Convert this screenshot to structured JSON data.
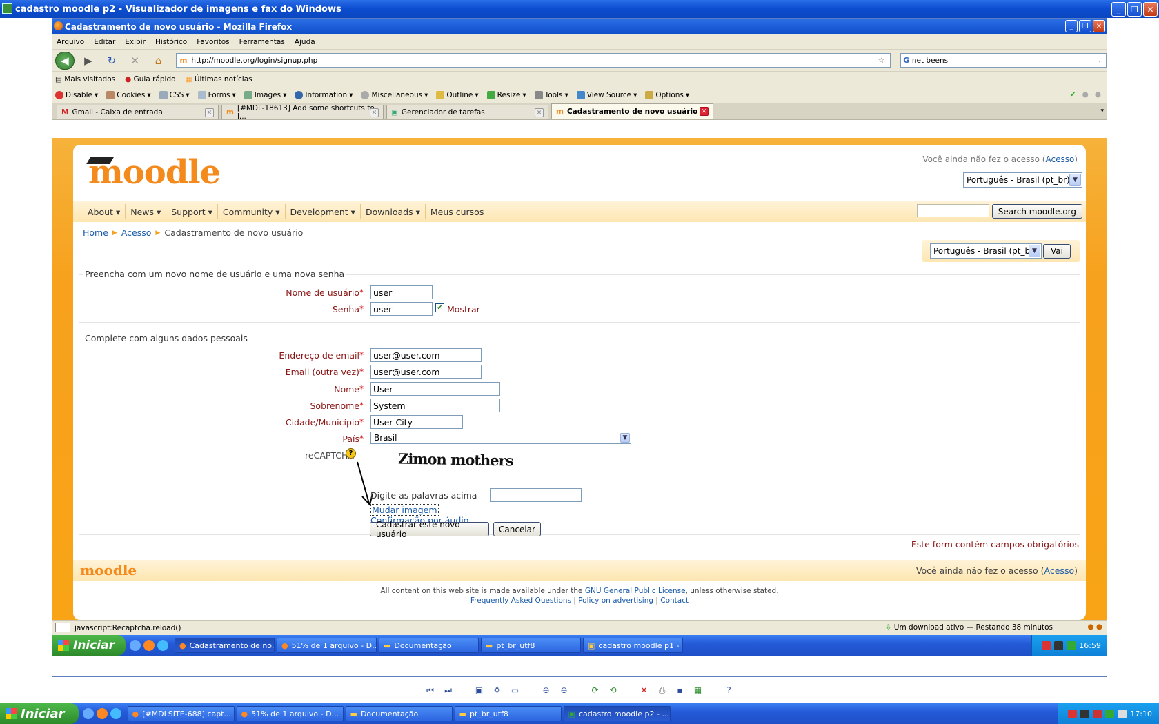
{
  "viewer": {
    "title": "cadastro moodle p2 - Visualizador de imagens e fax do Windows"
  },
  "firefox": {
    "title": "Cadastramento de novo usuário - Mozilla Firefox",
    "menu": [
      "Arquivo",
      "Editar",
      "Exibir",
      "Histórico",
      "Favoritos",
      "Ferramentas",
      "Ajuda"
    ],
    "url": "http://moodle.org/login/signup.php",
    "search_value": "net beens",
    "bookmarks": [
      "Mais visitados",
      "Guia rápido",
      "Últimas notícias"
    ],
    "devtools": [
      "Disable",
      "Cookies",
      "CSS",
      "Forms",
      "Images",
      "Information",
      "Miscellaneous",
      "Outline",
      "Resize",
      "Tools",
      "View Source",
      "Options"
    ],
    "tabs": [
      {
        "label": "Gmail - Caixa de entrada",
        "active": false
      },
      {
        "label": "[#MDL-18613] Add some shortcuts to i...",
        "active": false
      },
      {
        "label": "Gerenciador de tarefas",
        "active": false
      },
      {
        "label": "Cadastramento de novo usuário",
        "active": true
      }
    ],
    "status_text": "javascript:Recaptcha.reload()",
    "download_status": "Um download ativo — Restando 38 minutos"
  },
  "page": {
    "logo_text": "moodle",
    "login_prefix": "Você ainda não fez o acesso (",
    "login_link": "Acesso",
    "login_suffix": ")",
    "language": "Português - Brasil (pt_br)",
    "nav": [
      "About",
      "News",
      "Support",
      "Community",
      "Development",
      "Downloads",
      "Meus cursos"
    ],
    "search_button": "Search moodle.org",
    "breadcrumb": [
      "Home",
      "Acesso",
      "Cadastramento de novo usuário"
    ],
    "go_button": "Vai",
    "section1": {
      "legend": "Preencha com um novo nome de usuário e uma nova senha",
      "username_label": "Nome de usuário",
      "username_value": "user",
      "password_label": "Senha",
      "password_value": "user",
      "show_label": "Mostrar"
    },
    "section2": {
      "legend": "Complete com alguns dados pessoais",
      "email_label": "Endereço de email",
      "email_value": "user@user.com",
      "email2_label": "Email (outra vez)",
      "email2_value": "user@user.com",
      "firstname_label": "Nome",
      "firstname_value": "User",
      "lastname_label": "Sobrenome",
      "lastname_value": "System",
      "city_label": "Cidade/Município",
      "city_value": "User City",
      "country_label": "País",
      "country_value": "Brasil",
      "recaptcha_label": "reCAPTCHA",
      "captcha_words": "Zimon mothers",
      "captcha_prompt": "Digite as palavras acima",
      "change_image": "Mudar imagem",
      "audio": "Confirmação por áudio"
    },
    "submit_button": "Cadastrar este novo usuário",
    "cancel_button": "Cancelar",
    "required_note": "Este form contém campos obrigatórios",
    "footer_logo": "moodle",
    "license_prefix": "All content on this web site is made available under the ",
    "license_link": "GNU General Public License",
    "license_suffix": ", unless otherwise stated.",
    "footer_links": [
      "Frequently Asked Questions",
      "Policy on advertising",
      "Contact"
    ]
  },
  "inner_taskbar": {
    "start": "Iniciar",
    "items": [
      "Cadastramento de no...",
      "51% de 1 arquivo - D...",
      "Documentação",
      "pt_br_utf8",
      "cadastro moodle p1 - ..."
    ],
    "clock": "16:59"
  },
  "outer_taskbar": {
    "start": "Iniciar",
    "items": [
      "[#MDLSITE-688] capt...",
      "51% de 1 arquivo - D...",
      "Documentação",
      "pt_br_utf8",
      "cadastro moodle p2 - ..."
    ],
    "clock": "17:10"
  },
  "colors": {
    "moodle_orange": "#f48a1c",
    "required_red": "#8a1515",
    "link_blue": "#1a5aa8",
    "xp_blue": "#245ad8"
  }
}
